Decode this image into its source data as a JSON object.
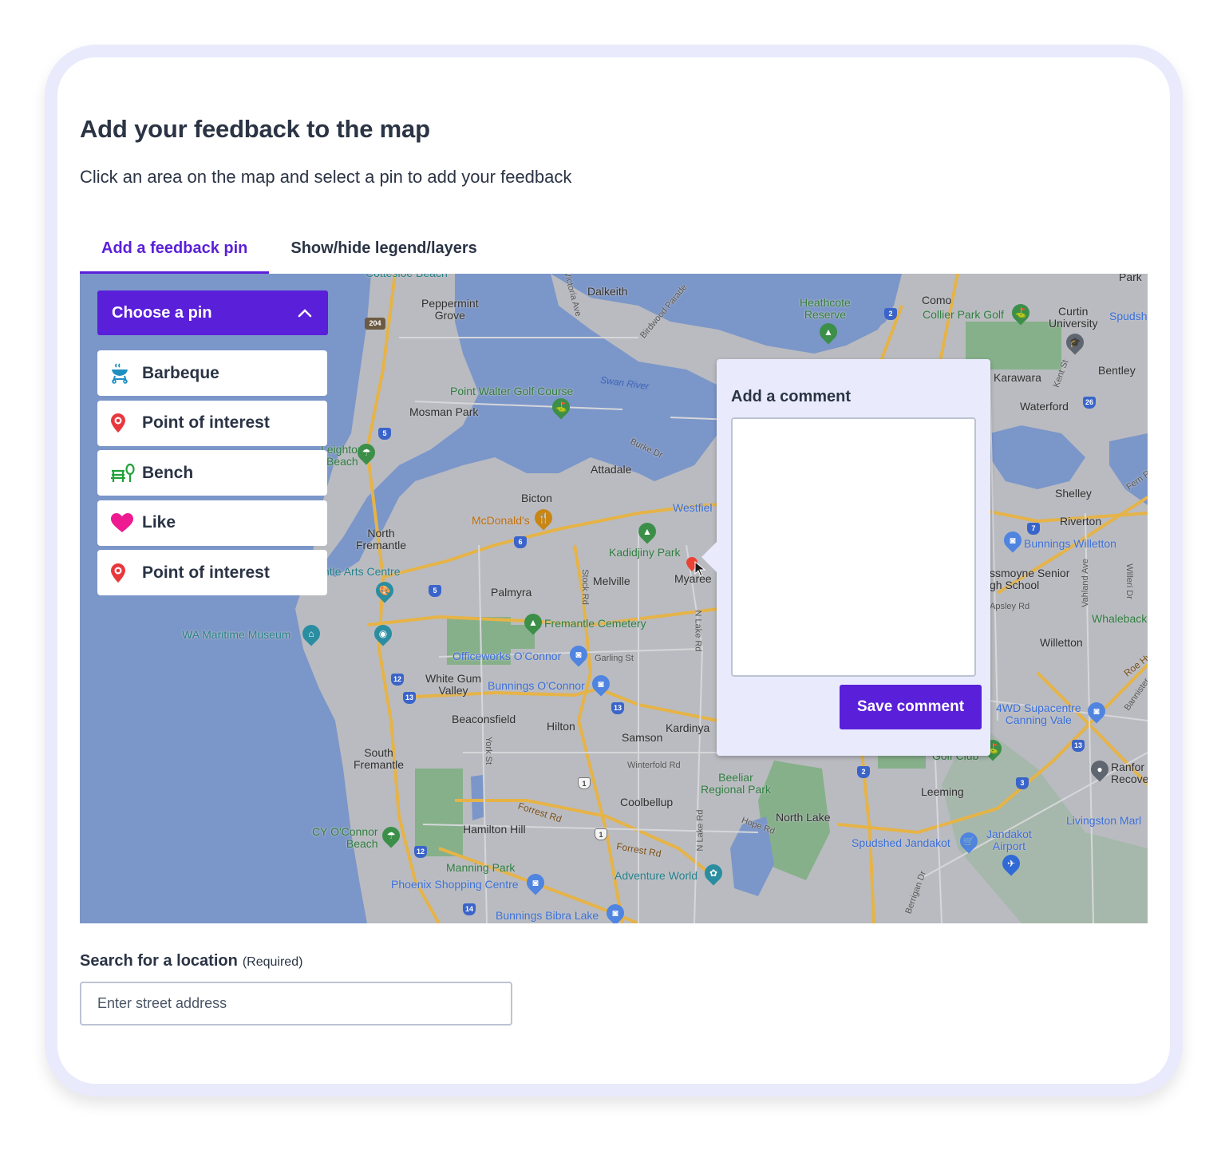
{
  "page": {
    "title": "Add your feedback to the map",
    "subtitle": "Click an area on the map and select a pin to add your feedback"
  },
  "tabs": [
    {
      "label": "Add a feedback pin",
      "active": true
    },
    {
      "label": "Show/hide legend/layers",
      "active": false
    }
  ],
  "pin_chooser": {
    "label": "Choose a pin",
    "expanded": true,
    "chevron_icon": "chevron-up-icon",
    "items": [
      {
        "label": "Barbeque",
        "icon": "barbeque-icon",
        "color": "#1f8fc0"
      },
      {
        "label": "Point of interest",
        "icon": "map-pin-icon",
        "color": "#e8383d"
      },
      {
        "label": "Bench",
        "icon": "bench-icon",
        "color": "#21a13a"
      },
      {
        "label": "Like",
        "icon": "heart-icon",
        "color": "#ee1a91"
      },
      {
        "label": "Point of interest",
        "icon": "map-pin-icon",
        "color": "#e8383d"
      }
    ]
  },
  "comment_popup": {
    "title": "Add a comment",
    "textarea_value": "",
    "save_label": "Save comment"
  },
  "search": {
    "label": "Search for a location",
    "required_label": "(Required)",
    "placeholder": "Enter street address",
    "value": ""
  },
  "colors": {
    "accent": "#5a1fd9",
    "frame": "#e9ebfc",
    "text": "#2b3445",
    "map_water": "#7b96c9",
    "map_land": "#b9bbc0",
    "map_park": "#86b08a",
    "map_highway": "#e6b347"
  },
  "map": {
    "labels": [
      {
        "text": "Cottesloe Beach",
        "style": "teal"
      },
      {
        "text": "Peppermint\nGrove",
        "style": "dark"
      },
      {
        "text": "Dalkeith",
        "style": "dark"
      },
      {
        "text": "Victoria Ave",
        "style": "road"
      },
      {
        "text": "Birdwood Parade",
        "style": "road"
      },
      {
        "text": "Heathcote\nReserve",
        "style": "green"
      },
      {
        "text": "Como",
        "style": "dark"
      },
      {
        "text": "Collier Park Golf",
        "style": "green"
      },
      {
        "text": "Curtin\nUniversity",
        "style": "dark"
      },
      {
        "text": "Spudsh",
        "style": "blue"
      },
      {
        "text": "Park",
        "style": "dark"
      },
      {
        "text": "Swan River",
        "style": "water"
      },
      {
        "text": "Point Walter Golf Course",
        "style": "green"
      },
      {
        "text": "Mosman Park",
        "style": "dark"
      },
      {
        "text": "Leighton\nBeach",
        "style": "green"
      },
      {
        "text": "Burke Dr",
        "style": "road"
      },
      {
        "text": "Attadale",
        "style": "dark"
      },
      {
        "text": "Karawara",
        "style": "dark"
      },
      {
        "text": "Kent St",
        "style": "road"
      },
      {
        "text": "Bentley",
        "style": "dark"
      },
      {
        "text": "Waterford",
        "style": "dark"
      },
      {
        "text": "Bicton",
        "style": "dark"
      },
      {
        "text": "McDonald's",
        "style": "orange"
      },
      {
        "text": "Westfiel",
        "style": "blue"
      },
      {
        "text": "North\nFremantle",
        "style": "dark"
      },
      {
        "text": "Kadidjiny Park",
        "style": "green"
      },
      {
        "text": "Myaree",
        "style": "dark"
      },
      {
        "text": "Shelley",
        "style": "dark"
      },
      {
        "text": "Fern R",
        "style": "road"
      },
      {
        "text": "Riverton",
        "style": "dark"
      },
      {
        "text": "Bunnings Willetton",
        "style": "blue"
      },
      {
        "text": "ntle Arts Centre",
        "style": "teal"
      },
      {
        "text": "Melville",
        "style": "dark"
      },
      {
        "text": "Stock Rd",
        "style": "road"
      },
      {
        "text": "Palmyra",
        "style": "dark"
      },
      {
        "text": "ssmoyne Senior\ngh School",
        "style": "dark"
      },
      {
        "text": "Vahland Ave",
        "style": "road"
      },
      {
        "text": "Willeri Dr",
        "style": "road"
      },
      {
        "text": "Apsley Rd",
        "style": "road"
      },
      {
        "text": "Whaleback",
        "style": "green"
      },
      {
        "text": "WA Maritime Museum",
        "style": "teal"
      },
      {
        "text": "Fremantle Cemetery",
        "style": "green"
      },
      {
        "text": "N Lake Rd",
        "style": "road"
      },
      {
        "text": "Willetton",
        "style": "dark"
      },
      {
        "text": "Officeworks O'Connor",
        "style": "blue"
      },
      {
        "text": "Garling St",
        "style": "road"
      },
      {
        "text": "Roe Hwy",
        "style": "roadbrown"
      },
      {
        "text": "White Gum\nValley",
        "style": "dark"
      },
      {
        "text": "Bunnings O'Connor",
        "style": "blue"
      },
      {
        "text": "Bannister",
        "style": "road"
      },
      {
        "text": "4WD Supacentre\nCanning Vale",
        "style": "blue"
      },
      {
        "text": "Beaconsfield",
        "style": "dark"
      },
      {
        "text": "Hilton",
        "style": "dark"
      },
      {
        "text": "Kardinya",
        "style": "dark"
      },
      {
        "text": "Samson",
        "style": "dark"
      },
      {
        "text": "York St",
        "style": "road"
      },
      {
        "text": "Golf Club",
        "style": "green"
      },
      {
        "text": "South\nFremantle",
        "style": "dark"
      },
      {
        "text": "Winterfold Rd",
        "style": "road"
      },
      {
        "text": "Beeliar\nRegional Park",
        "style": "green"
      },
      {
        "text": "Ranfor\nRecove",
        "style": "dark"
      },
      {
        "text": "Leeming",
        "style": "dark"
      },
      {
        "text": "Coolbellup",
        "style": "dark"
      },
      {
        "text": "Forrest Rd",
        "style": "roadbrown"
      },
      {
        "text": "Hope Rd",
        "style": "road"
      },
      {
        "text": "North Lake",
        "style": "dark"
      },
      {
        "text": "Livingston Marl",
        "style": "blue"
      },
      {
        "text": "CY O'Connor\nBeach",
        "style": "green"
      },
      {
        "text": "Hamilton Hill",
        "style": "dark"
      },
      {
        "text": "Spudshed Jandakot",
        "style": "blue"
      },
      {
        "text": "Jandakot\nAirport",
        "style": "blue"
      },
      {
        "text": "Forrest Rd",
        "style": "roadbrown"
      },
      {
        "text": "Manning Park",
        "style": "green"
      },
      {
        "text": "Adventure World",
        "style": "teal"
      },
      {
        "text": "Phoenix Shopping Centre",
        "style": "blue"
      },
      {
        "text": "Berrigan Dr",
        "style": "road"
      },
      {
        "text": "Bunnings Bibra Lake",
        "style": "blue"
      }
    ],
    "route_shields": [
      "204",
      "2",
      "26",
      "5",
      "5",
      "6",
      "7",
      "12",
      "13",
      "13",
      "1",
      "1",
      "2",
      "3",
      "12",
      "14",
      "13"
    ]
  }
}
